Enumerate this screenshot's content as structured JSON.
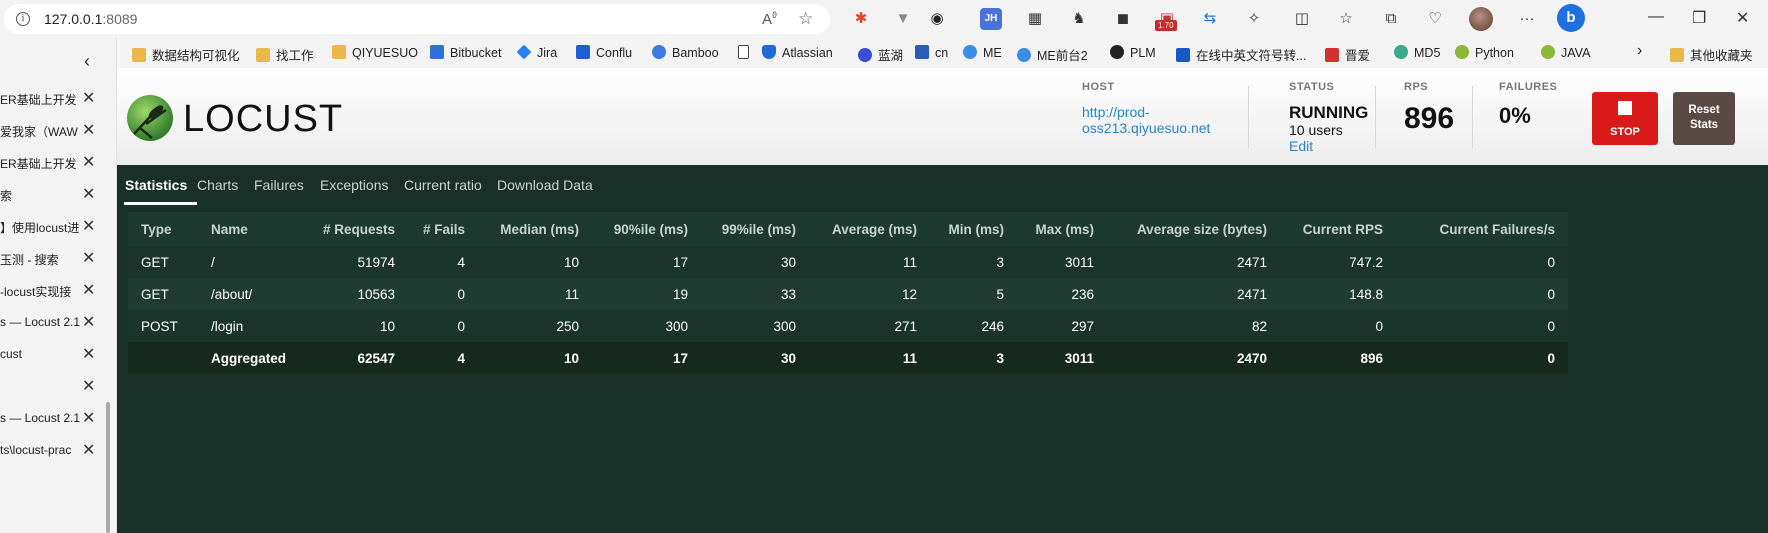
{
  "browser": {
    "url_host": "127.0.0.1",
    "url_port": ":8089",
    "extensions": [
      "color-wheel-icon",
      "vivaldi-icon",
      "w-icon",
      "jh-icon",
      "qr-icon",
      "bird-icon",
      "game-icon",
      "badge-ext-icon",
      "translate-icon",
      "puzzle-icon",
      "split-screen-icon",
      "favorites-icon",
      "collections-icon",
      "health-icon"
    ],
    "badge_count": "1.70",
    "window_controls": [
      "minimize",
      "restore",
      "close"
    ]
  },
  "bookmarks": [
    {
      "label": "数据结构可视化",
      "icon": "folder"
    },
    {
      "label": "找工作",
      "icon": "folder"
    },
    {
      "label": "QIYUESUO",
      "icon": "folder"
    },
    {
      "label": "Bitbucket",
      "icon": "bitbucket"
    },
    {
      "label": "Jira",
      "icon": "jira"
    },
    {
      "label": "Conflu",
      "icon": "confluence"
    },
    {
      "label": "Bamboo",
      "icon": "bamboo"
    },
    {
      "label": "",
      "icon": "page"
    },
    {
      "label": "Atlassian",
      "icon": "atlassian"
    },
    {
      "label": "蓝湖",
      "icon": "lanhu"
    },
    {
      "label": "cn",
      "icon": "cn"
    },
    {
      "label": "ME",
      "icon": "me"
    },
    {
      "label": "ME前台2",
      "icon": "me"
    },
    {
      "label": "PLM",
      "icon": "plm"
    },
    {
      "label": "在线中英文符号转...",
      "icon": "u"
    },
    {
      "label": "晋爱",
      "icon": "grid"
    },
    {
      "label": "MD5",
      "icon": "gear"
    },
    {
      "label": "Python",
      "icon": "leaf"
    },
    {
      "label": "JAVA",
      "icon": "leaf"
    },
    {
      "label": "其他收藏夹",
      "icon": "folder"
    }
  ],
  "tabs": [
    {
      "label": "ER基础上开发"
    },
    {
      "label": "爱我家（WAW"
    },
    {
      "label": "ER基础上开发"
    },
    {
      "label": "索"
    },
    {
      "label": "】使用locust进"
    },
    {
      "label": "玉测 - 搜索"
    },
    {
      "label": "-locust实现接"
    },
    {
      "label": "s — Locust 2.1"
    },
    {
      "label": "cust"
    },
    {
      "label": ""
    },
    {
      "label": "s — Locust 2.1"
    },
    {
      "label": "ts\\locust-prac"
    }
  ],
  "locust": {
    "logo_text": "LOCUST",
    "host_label": "HOST",
    "host": "http://prod-oss213.qiyuesuo.net",
    "status_label": "STATUS",
    "status": "RUNNING",
    "users": "10 users",
    "edit": "Edit",
    "rps_label": "RPS",
    "rps": "896",
    "failures_label": "FAILURES",
    "failures": "0%",
    "stop": "STOP",
    "reset": "Reset Stats",
    "nav": [
      "Statistics",
      "Charts",
      "Failures",
      "Exceptions",
      "Current ratio",
      "Download Data"
    ],
    "active_nav": "Statistics",
    "colors": {
      "stop": "#d91a1a",
      "reset": "#5a4a46",
      "bg": "#183027",
      "link": "#2a86c4"
    }
  },
  "table": {
    "headers": [
      "Type",
      "Name",
      "# Requests",
      "# Fails",
      "Median (ms)",
      "90%ile (ms)",
      "99%ile (ms)",
      "Average (ms)",
      "Min (ms)",
      "Max (ms)",
      "Average size (bytes)",
      "Current RPS",
      "Current Failures/s"
    ],
    "rows": [
      [
        "GET",
        "/",
        "51974",
        "4",
        "10",
        "17",
        "30",
        "11",
        "3",
        "3011",
        "2471",
        "747.2",
        "0"
      ],
      [
        "GET",
        "/about/",
        "10563",
        "0",
        "11",
        "19",
        "33",
        "12",
        "5",
        "236",
        "2471",
        "148.8",
        "0"
      ],
      [
        "POST",
        "/login",
        "10",
        "0",
        "250",
        "300",
        "300",
        "271",
        "246",
        "297",
        "82",
        "0",
        "0"
      ],
      [
        "",
        "Aggregated",
        "62547",
        "4",
        "10",
        "17",
        "30",
        "11",
        "3",
        "3011",
        "2470",
        "896",
        "0"
      ]
    ]
  }
}
